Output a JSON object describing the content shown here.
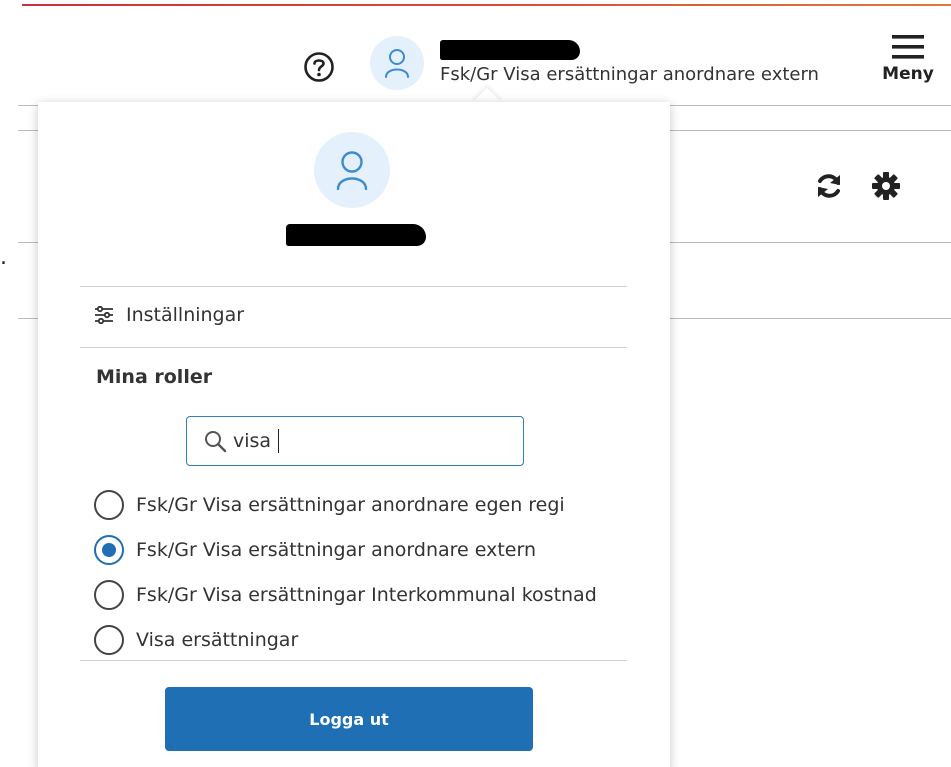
{
  "header": {
    "current_role": "Fsk/Gr Visa ersättningar anordnare extern",
    "menu_label": "Meny",
    "help_icon": "question-circle-icon",
    "avatar_icon": "user-icon"
  },
  "toolbar": {
    "refresh_icon": "refresh-icon",
    "settings_icon": "gear-icon"
  },
  "background": {
    "fragment_text": "."
  },
  "popover": {
    "settings_label": "Inställningar",
    "settings_icon": "sliders-icon",
    "roles_title": "Mina roller",
    "search": {
      "value": "visa",
      "icon": "search-icon"
    },
    "roles": [
      {
        "label": "Fsk/Gr Visa ersättningar anordnare egen regi",
        "selected": false
      },
      {
        "label": "Fsk/Gr Visa ersättningar anordnare extern",
        "selected": true
      },
      {
        "label": "Fsk/Gr Visa ersättningar Interkommunal kostnad",
        "selected": false
      },
      {
        "label": "Visa ersättningar",
        "selected": false
      }
    ],
    "logout_label": "Logga ut"
  },
  "colors": {
    "primary": "#1f6fb5",
    "avatar_bg": "#e4f0fb",
    "accent_top": "#c8323c"
  }
}
